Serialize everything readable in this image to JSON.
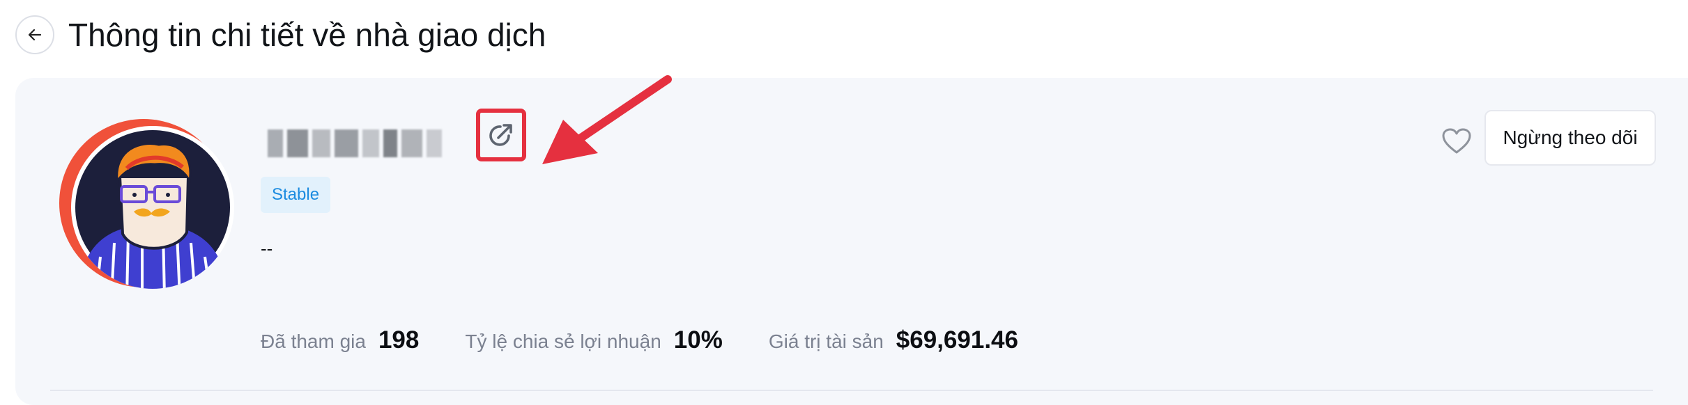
{
  "header": {
    "title": "Thông tin chi tiết về nhà giao dịch"
  },
  "trader": {
    "tag": "Stable",
    "bio": "--"
  },
  "stats": [
    {
      "label": "Đã tham gia",
      "value": "198"
    },
    {
      "label": "Tỷ lệ chia sẻ lợi nhuận",
      "value": "10%"
    },
    {
      "label": "Giá trị tài sản",
      "value": "$69,691.46"
    }
  ],
  "actions": {
    "unfollow_label": "Ngừng theo dõi"
  },
  "icons": {
    "back": "arrow-left-icon",
    "share": "external-share-icon",
    "favorite": "heart-outline-icon"
  },
  "colors": {
    "annotation_red": "#e5303f",
    "tag_text": "#1b8be0",
    "tag_bg": "#e2f1fc",
    "card_bg": "#f5f7fb",
    "avatar_bg": "#1c1f3b",
    "avatar_ring": "#f0513a"
  }
}
